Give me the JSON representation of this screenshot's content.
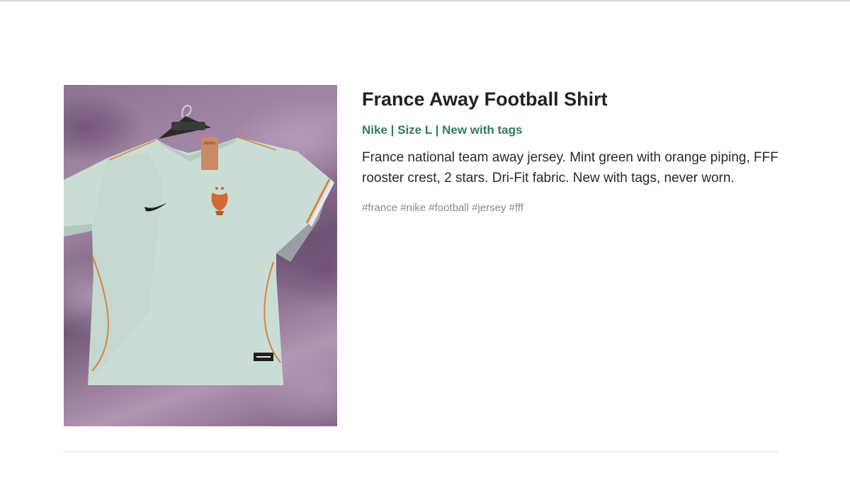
{
  "listing": {
    "title": "France Away Football Shirt",
    "meta": "Nike | Size L | New with tags",
    "description": "France national team away jersey. Mint green with orange piping, FFF rooster crest, 2 stars. Dri-Fit fabric. New with tags, never worn.",
    "tags": "#france #nike #football #jersey #fff",
    "photo_icon": "shirt-photo",
    "colors": {
      "accent": "#2e7d5b",
      "shirt": "#cfe3da",
      "piping": "#d9813f"
    }
  }
}
